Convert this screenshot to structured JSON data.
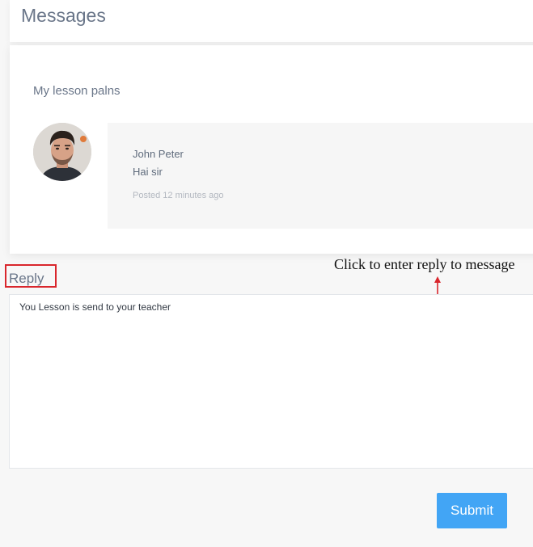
{
  "header": {
    "title": "Messages"
  },
  "thread": {
    "title": "My lesson palns",
    "message": {
      "sender": "John Peter",
      "body": "Hai sir",
      "posted": "Posted 12 minutes ago",
      "avatar_icon": "user-avatar-photo"
    }
  },
  "reply": {
    "label": "Reply",
    "text": "You Lesson is send to your teacher",
    "submit_label": "Submit"
  },
  "annotation": {
    "text": "Click to enter reply to message",
    "arrow_icon": "arrow-up-icon",
    "color": "#d9262c"
  },
  "colors": {
    "accent": "#42a5f5",
    "annotation_red": "#d9262c",
    "muted_text": "#6a7689"
  }
}
